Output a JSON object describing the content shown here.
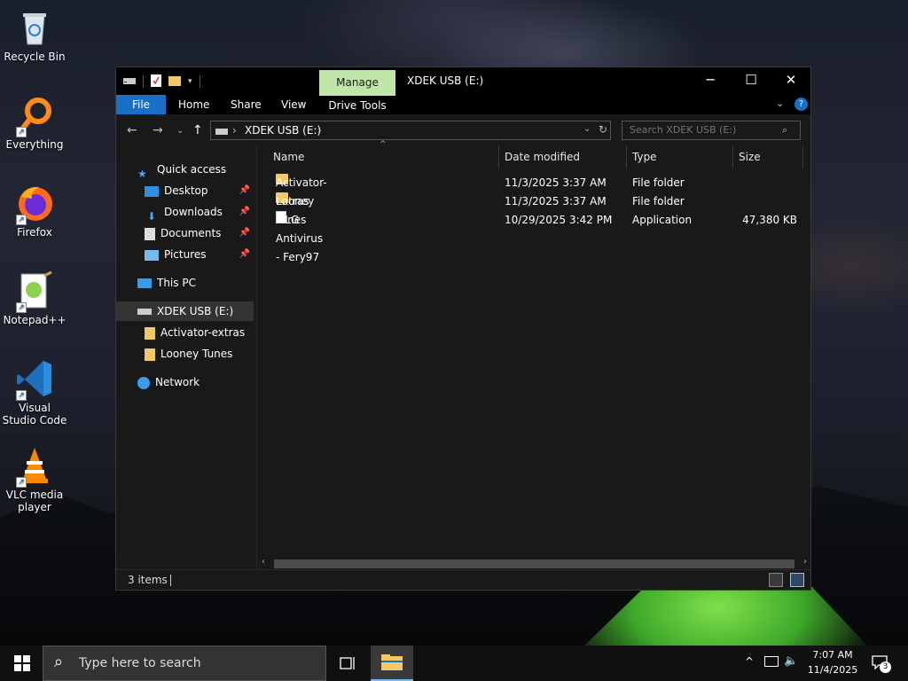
{
  "desktop": {
    "icons": [
      {
        "label": "Recycle Bin"
      },
      {
        "label": "Everything"
      },
      {
        "label": "Firefox"
      },
      {
        "label": "Notepad++"
      },
      {
        "label": "Visual Studio Code"
      },
      {
        "label": "VLC media player"
      }
    ]
  },
  "window": {
    "title": "XDEK USB (E:)",
    "manage_label": "Manage",
    "ribbon": {
      "file": "File",
      "home": "Home",
      "share": "Share",
      "view": "View",
      "drive_tools": "Drive Tools"
    },
    "address": {
      "crumb": "XDEK USB (E:)"
    },
    "search": {
      "placeholder": "Search XDEK USB (E:)"
    },
    "nav": {
      "quick_access": "Quick access",
      "desktop": "Desktop",
      "downloads": "Downloads",
      "documents": "Documents",
      "pictures": "Pictures",
      "this_pc": "This PC",
      "usb": "XDEK USB (E:)",
      "sub1": "Activator-extras",
      "sub2": "Looney Tunes",
      "network": "Network"
    },
    "columns": {
      "name": "Name",
      "date": "Date modified",
      "type": "Type",
      "size": "Size"
    },
    "files": [
      {
        "name": "Activator-extras",
        "date": "11/3/2025 3:37 AM",
        "type": "File folder",
        "size": ""
      },
      {
        "name": "Looney Tunes",
        "date": "11/3/2025 3:37 AM",
        "type": "File folder",
        "size": ""
      },
      {
        "name": "MLG Antivirus - Fery97",
        "date": "10/29/2025 3:42 PM",
        "type": "Application",
        "size": "47,380 KB"
      }
    ],
    "status": "3 items"
  },
  "taskbar": {
    "search_text": "Type here to search",
    "time": "7:07 AM",
    "date": "11/4/2025",
    "notifications": "3"
  },
  "colors": {
    "accent": "#1a6fc9",
    "manage_tab": "#bfe6a6",
    "folder": "#f3c867",
    "window_bg": "#191919"
  }
}
